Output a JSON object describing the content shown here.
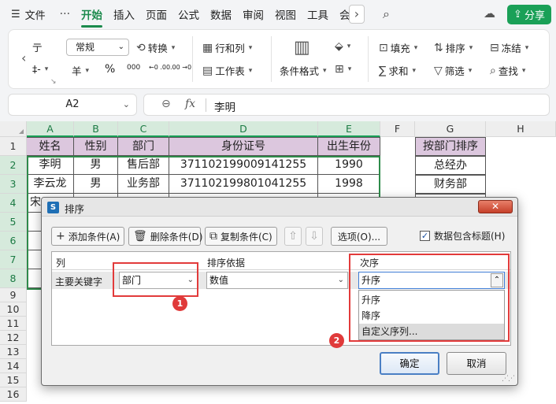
{
  "menu": {
    "file": "文件",
    "more": "···",
    "tabs": [
      {
        "label": "开始",
        "active": true
      },
      {
        "label": "插入"
      },
      {
        "label": "页面"
      },
      {
        "label": "公式"
      },
      {
        "label": "数据"
      },
      {
        "label": "审阅"
      },
      {
        "label": "视图"
      },
      {
        "label": "工具"
      },
      {
        "label": "会"
      }
    ],
    "share": "分享"
  },
  "ribbon": {
    "partial_top": "亍",
    "partial_bottom": "‡‐",
    "number_format": "常规",
    "convert": "转换",
    "currency": "羊",
    "percent": "%",
    "thousands": "000",
    "dec_inc": "←0 .00",
    "dec_dec": ".00 →0",
    "row_col": "行和列",
    "worksheet": "工作表",
    "cond_format": "条件格式",
    "fill": "填充",
    "sort": "排序",
    "freeze": "冻结",
    "sum": "求和",
    "filter": "筛选",
    "find": "查找"
  },
  "formula_bar": {
    "cell_ref": "A2",
    "fx": "fx",
    "value": "李明"
  },
  "sheet": {
    "columns": [
      "A",
      "B",
      "C",
      "D",
      "E",
      "F",
      "G",
      "H"
    ],
    "rows": [
      "1",
      "2",
      "3",
      "4",
      "5",
      "6",
      "7",
      "8",
      "9",
      "10",
      "11",
      "12",
      "13",
      "14",
      "15",
      "16"
    ],
    "header": [
      "姓名",
      "性别",
      "部门",
      "身份证号",
      "出生年份"
    ],
    "data": [
      [
        "李明",
        "男",
        "售后部",
        "371102199009141255",
        "1990"
      ],
      [
        "李云龙",
        "男",
        "业务部",
        "371102199801041255",
        "1998"
      ]
    ],
    "partial_row4_a": "宋",
    "g_header": "按部门排序",
    "g_values": [
      "总经办",
      "财务部"
    ]
  },
  "dialog": {
    "title": "排序",
    "close": "✕",
    "add_condition": "添加条件(A)",
    "delete_condition": "删除条件(D)",
    "copy_condition": "复制条件(C)",
    "options": "选项(O)...",
    "has_header": "数据包含标题(H)",
    "col_header": "列",
    "basis_header": "排序依据",
    "order_header": "次序",
    "primary_key_label": "主要关键字",
    "primary_key_value": "部门",
    "basis_value": "数值",
    "order_value": "升序",
    "order_options": [
      "升序",
      "降序",
      "自定义序列..."
    ],
    "ok": "确定",
    "cancel": "取消"
  },
  "annotations": {
    "badge1": "1",
    "badge2": "2"
  }
}
